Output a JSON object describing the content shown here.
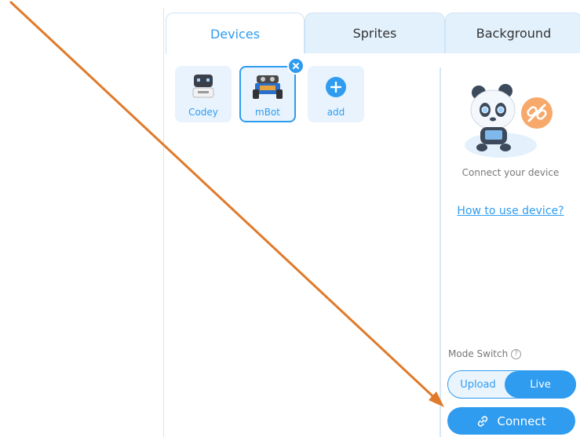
{
  "tabs": [
    {
      "label": "Devices"
    },
    {
      "label": "Sprites"
    },
    {
      "label": "Background"
    }
  ],
  "devices": [
    {
      "label": "Codey",
      "icon": "codey-robot-icon"
    },
    {
      "label": "mBot",
      "icon": "mbot-robot-icon"
    },
    {
      "label": "add",
      "icon": "plus-circle-icon"
    }
  ],
  "right_panel": {
    "connect_text": "Connect your device",
    "howto_link": "How to use device?",
    "mode_switch_label": "Mode Switch",
    "mode_options": [
      "Upload",
      "Live"
    ],
    "selected_mode": "Live",
    "connect_button": "Connect"
  },
  "colors": {
    "accent": "#2f9cf0",
    "annotation_arrow": "#e07a2a"
  }
}
